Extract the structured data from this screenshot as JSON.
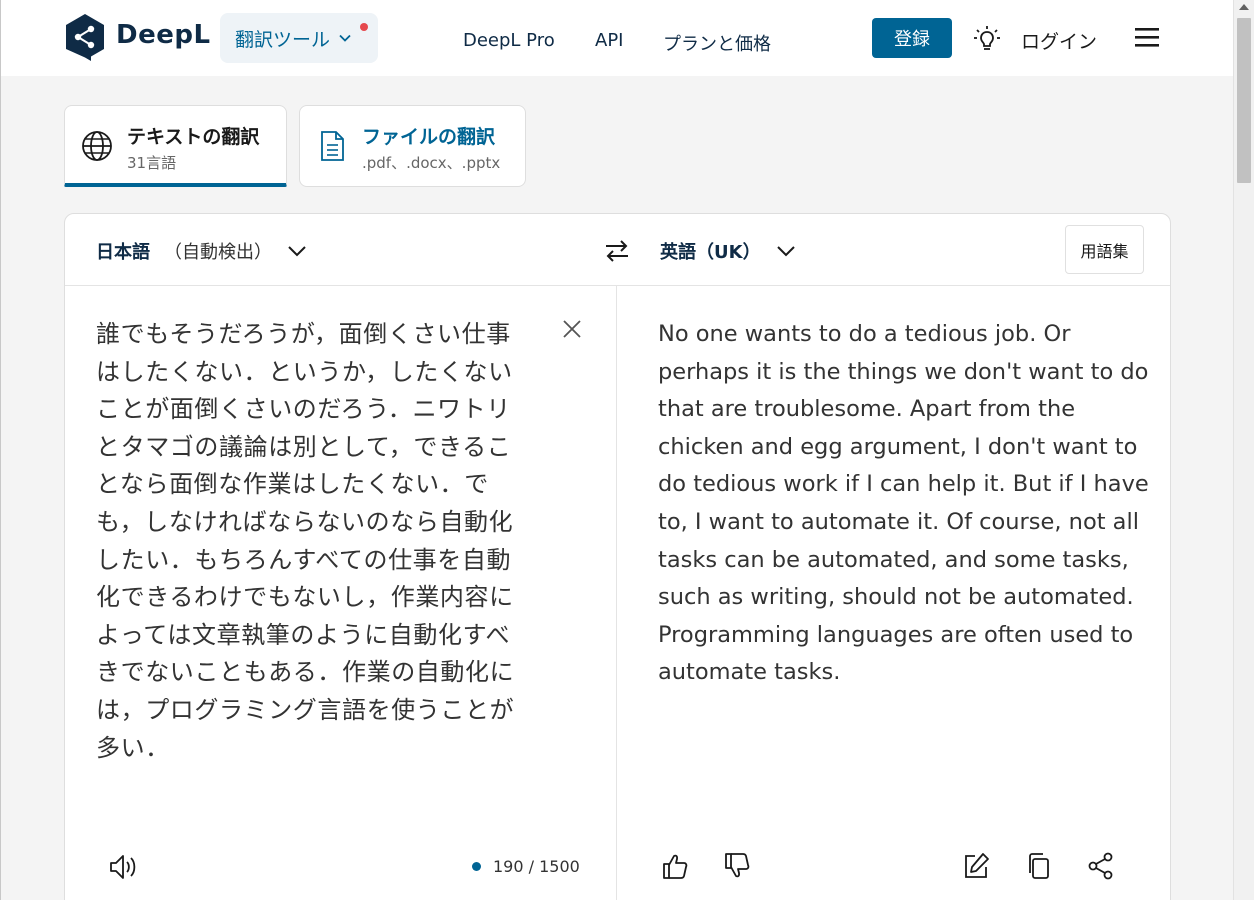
{
  "header": {
    "brand": "DeepL",
    "tool_menu_label": "翻訳ツール",
    "nav": [
      "DeepL Pro",
      "API",
      "プランと価格"
    ],
    "register_label": "登録",
    "login_label": "ログイン"
  },
  "mode_tabs": [
    {
      "title": "テキストの翻訳",
      "subtitle": "31言語",
      "icon": "globe-icon",
      "active": true
    },
    {
      "title": "ファイルの翻訳",
      "subtitle": ".pdf、.docx、.pptx",
      "icon": "document-icon",
      "active": false
    }
  ],
  "translator": {
    "source_language": "日本語",
    "source_detect": "（自動検出）",
    "target_language": "英語（UK）",
    "glossary_label": "用語集",
    "source_text": "誰でもそうだろうが，面倒くさい仕事はしたくない．というか，したくないことが面倒くさいのだろう．ニワトリとタマゴの議論は別として，できることなら面倒な作業はしたくない．でも，しなければならないのなら自動化したい．もちろんすべての仕事を自動化できるわけでもないし，作業内容によっては文章執筆のように自動化すべきでないこともある．作業の自動化には，プログラミング言語を使うことが多い．",
    "target_text": "No one wants to do a tedious job. Or perhaps it is the things we don't want to do that are troublesome. Apart from the chicken and egg argument, I don't want to do tedious work if I can help it. But if I have to, I want to automate it. Of course, not all tasks can be automated, and some tasks, such as writing, should not be automated. Programming languages are often used to automate tasks.",
    "char_count": "190 / 1500"
  },
  "colors": {
    "accent": "#006494",
    "brand_dark": "#0f2b46",
    "notification_dot": "#e5484d"
  }
}
